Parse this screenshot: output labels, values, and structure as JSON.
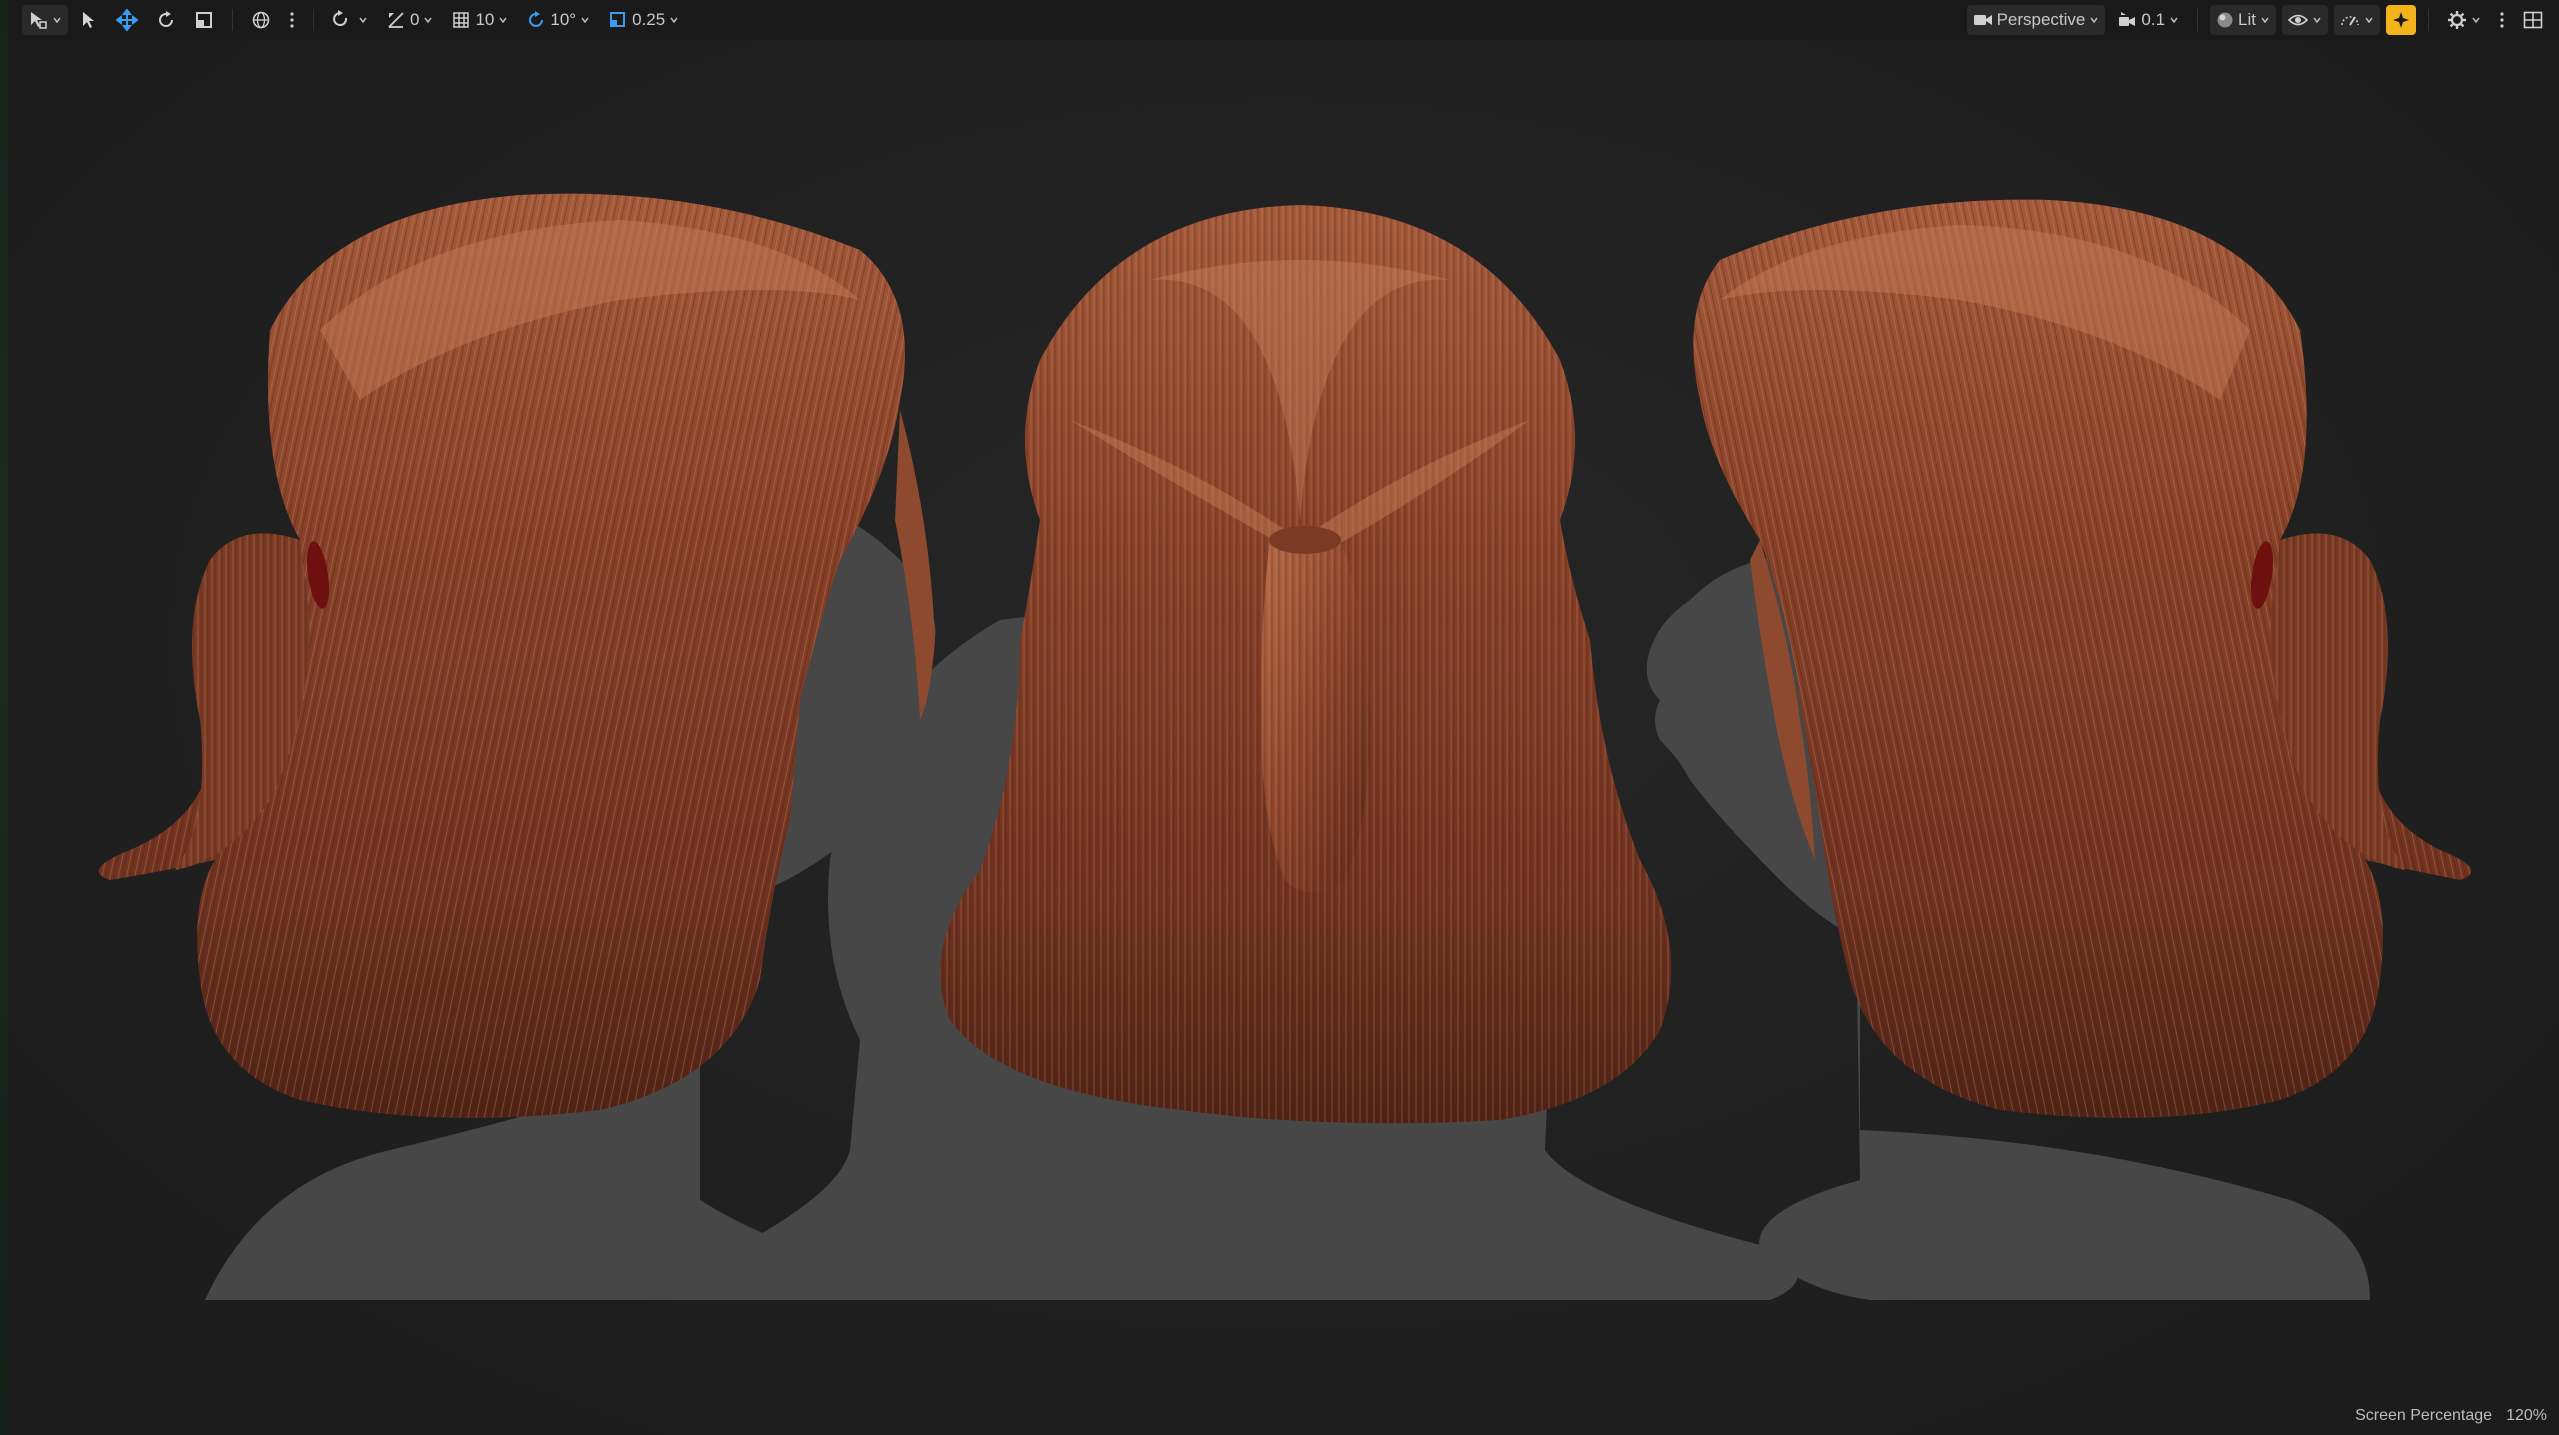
{
  "toolbar": {
    "left": {
      "select_mode_icon": "select-mode-icon",
      "rotation_snap_value": "0",
      "grid_snap_value": "10",
      "rotation_angle_value": "10°",
      "scale_snap_value": "0.25"
    },
    "right": {
      "view_mode_label": "Perspective",
      "camera_speed_value": "0.1",
      "lighting_mode_label": "Lit"
    }
  },
  "viewport": {
    "screen_percentage_label": "Screen Percentage",
    "screen_percentage_value": "120%"
  },
  "colors": {
    "toolbar_bg": "#1a1a1a",
    "viewport_bg": "#202020",
    "mannequin": "#494949",
    "hair_base": "#7a3a22",
    "hair_highlight": "#d28a62",
    "snap_active": "#f2b31b",
    "move_tool_accent": "#3b9bf0"
  }
}
